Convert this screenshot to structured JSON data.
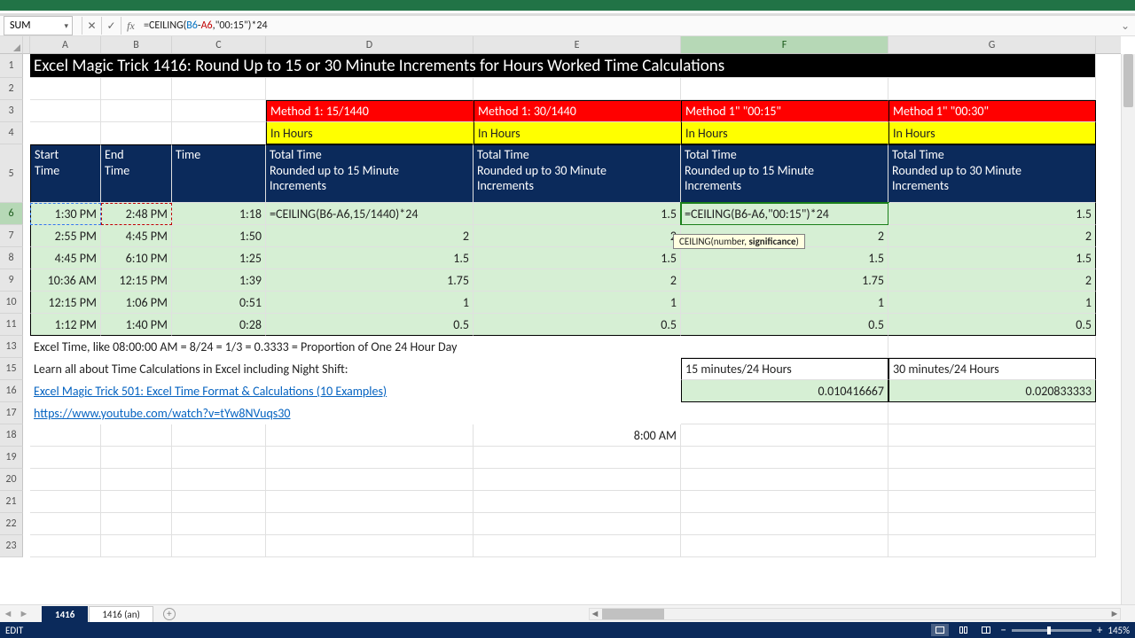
{
  "app": {
    "namebox": "SUM",
    "formula_html": "=CEILING(<span class='rgBlue'>B6</span>-<span class='rgRed'>A6</span>,\"00:15\")*24"
  },
  "cols": [
    "A",
    "B",
    "C",
    "D",
    "E",
    "F",
    "G"
  ],
  "rows_shown": [
    1,
    2,
    3,
    4,
    5,
    6,
    7,
    8,
    9,
    10,
    11,
    13,
    15,
    16,
    17,
    18,
    19,
    20,
    21,
    22,
    23
  ],
  "row_h": {
    "1": 27,
    "5": 66
  },
  "title": "Excel Magic Trick 1416: Round Up to 15 or 30 Minute Increments for Hours Worked Time Calculations",
  "methods": {
    "D": "Method 1: 15/1440",
    "E": "Method 1: 30/1440",
    "F": "Method 1\" \"00:15\"",
    "G": "Method 1\" \"00:30\""
  },
  "inhours": "In Hours",
  "head5": {
    "A": "Start\nTime",
    "B": "End\nTime",
    "C": "Time",
    "D": "Total Time\nRounded up to 15 Minute\nIncrements",
    "E": "Total Time\nRounded up to 30 Minute\nIncrements",
    "F": "Total Time\nRounded up to 15 Minute\nIncrements",
    "G": "Total Time\nRounded up to 30 Minute\nIncrements"
  },
  "data_rows": [
    {
      "r": 6,
      "A": "1:30 PM",
      "B": "2:48 PM",
      "C": "1:18",
      "D_formula": "=CEILING(<span class='rgBlue'>B6</span>-<span class='rgRed'>A6</span>,15/1440)*24",
      "E": "1.5",
      "F_formula": "=CEILING(<span class='rgBlue'>B6</span>-<span class='rgRed'>A6</span>,\"00:15\")*24",
      "G": "1.5"
    },
    {
      "r": 7,
      "A": "2:55 PM",
      "B": "4:45 PM",
      "C": "1:50",
      "D": "2",
      "E": "2",
      "F": "2",
      "G": "2"
    },
    {
      "r": 8,
      "A": "4:45 PM",
      "B": "6:10 PM",
      "C": "1:25",
      "D": "1.5",
      "E": "1.5",
      "F": "1.5",
      "G": "1.5"
    },
    {
      "r": 9,
      "A": "10:36 AM",
      "B": "12:15 PM",
      "C": "1:39",
      "D": "1.75",
      "E": "2",
      "F": "1.75",
      "G": "2"
    },
    {
      "r": 10,
      "A": "12:15 PM",
      "B": "1:06 PM",
      "C": "0:51",
      "D": "1",
      "E": "1",
      "F": "1",
      "G": "1"
    },
    {
      "r": 11,
      "A": "1:12 PM",
      "B": "1:40 PM",
      "C": "0:28",
      "D": "0.5",
      "E": "0.5",
      "F": "0.5",
      "G": "0.5"
    }
  ],
  "row13": "Excel Time, like 08:00:00 AM = 8/24 = 1/3 = 0.3333 = Proportion of One 24 Hour Day",
  "row15_text": "Learn all about Time Calculations in Excel including Night Shift:",
  "row15_F": "15 minutes/24 Hours",
  "row15_G": "30 minutes/24 Hours",
  "row16_link": "Excel Magic Trick 501: Excel Time Format & Calculations (10 Examples) ",
  "row16_F": "0.010416667",
  "row16_G": "0.020833333",
  "row17_link": "https://www.youtube.com/watch?v=tYw8NVuqs30",
  "row18_E": "8:00 AM",
  "tooltip": "CEILING(number, <b>significance</b>)",
  "tabs": {
    "active": "1416",
    "other": "1416 (an)"
  },
  "status": {
    "mode": "EDIT",
    "zoom": "145%"
  }
}
